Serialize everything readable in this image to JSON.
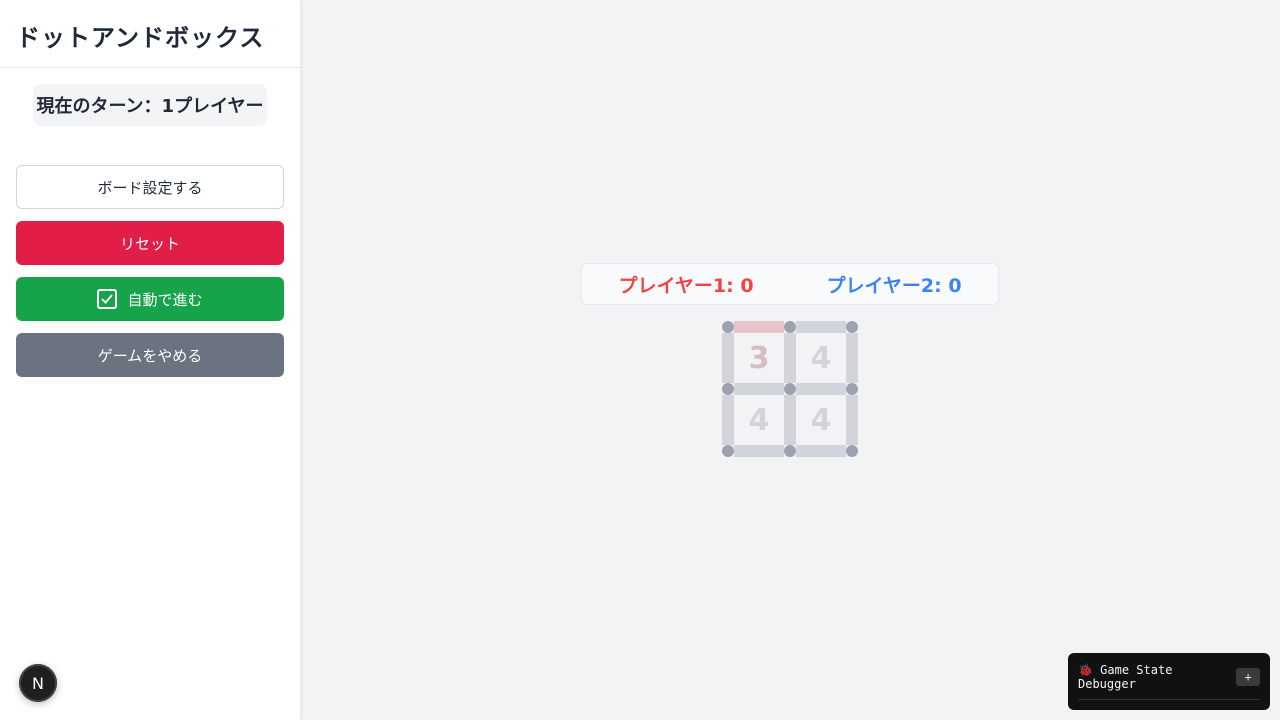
{
  "sidebar": {
    "title": "ドットアンドボックス",
    "turn": "現在のターン：1プレイヤー",
    "buttons": {
      "secondary": "ボード設定する",
      "danger": "リセット",
      "success": "自動で進む",
      "neutral": "ゲームをやめる"
    }
  },
  "scoreboard": {
    "player1": "プレイヤー1: 0",
    "player2": "プレイヤー2: 0"
  },
  "board": {
    "rows": 2,
    "cols": 2,
    "cells": [
      "3",
      "4",
      "4",
      "4"
    ],
    "claimed_edges": [
      "h-0-0"
    ]
  },
  "debugger": {
    "title": "🐞 Game State Debugger",
    "toggle": "+"
  },
  "badge": {
    "letter": "N"
  },
  "colors": {
    "player1": "#ef4444",
    "player2": "#3b82f6",
    "danger": "#e11d48",
    "success": "#16a34a",
    "neutral": "#6b7280"
  }
}
